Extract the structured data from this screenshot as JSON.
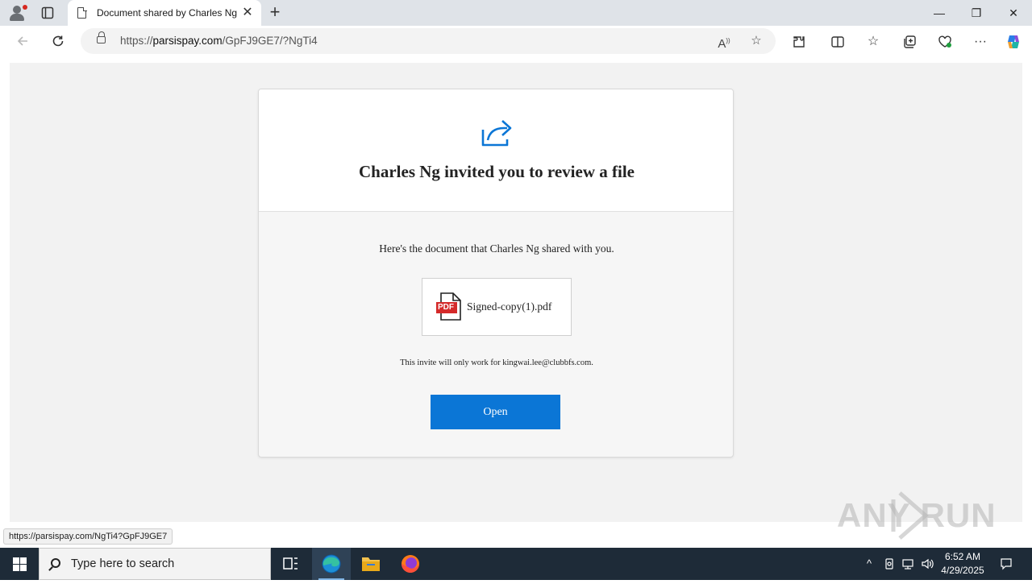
{
  "browser": {
    "tab": {
      "title": "Document shared by Charles Ng",
      "close_label": "✕"
    },
    "newtab_label": "+",
    "window_controls": {
      "minimize": "—",
      "restore": "❐",
      "close": "✕"
    },
    "address": {
      "prefix": "https://",
      "host": "parsispay.com",
      "path": "/GpFJ9GE7/?NgTi4"
    }
  },
  "page": {
    "title": "Charles Ng invited you to review a file",
    "subtitle": "Here's the document that Charles Ng shared with you.",
    "file": {
      "name": "Signed-copy(1).pdf",
      "icon_label": "PDF"
    },
    "invite_note": "This invite will only work for kingwai.lee@clubbfs.com.",
    "open_button": "Open",
    "accent_color": "#0b76d6"
  },
  "status_bar": {
    "url": "https://parsispay.com/NgTi4?GpFJ9GE7"
  },
  "watermark": {
    "text": "ANY RUN"
  },
  "taskbar": {
    "search_placeholder": "Type here to search",
    "time": "6:52 AM",
    "date": "4/29/2025"
  }
}
